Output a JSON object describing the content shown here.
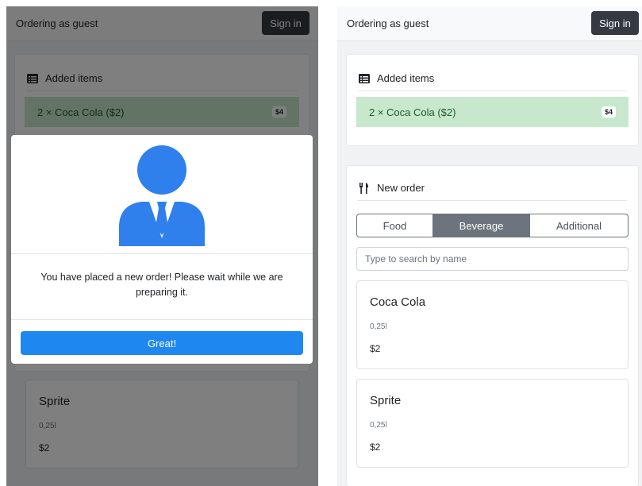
{
  "navbar": {
    "title": "Ordering as guest",
    "signin_label": "Sign in"
  },
  "added_items": {
    "title": "Added items",
    "rows": [
      {
        "text": "2 × Coca Cola ($2)",
        "total": "$4"
      }
    ]
  },
  "new_order": {
    "title": "New order",
    "tabs": [
      {
        "label": "Food"
      },
      {
        "label": "Beverage"
      },
      {
        "label": "Additional"
      }
    ],
    "active_tab": "Beverage",
    "search_placeholder": "Type to search by name"
  },
  "products": [
    {
      "name": "Coca Cola",
      "volume": "0,25l",
      "price": "$2"
    },
    {
      "name": "Sprite",
      "volume": "0,25l",
      "price": "$2"
    }
  ],
  "modal": {
    "message": "You have placed a new order! Please wait while we are preparing it.",
    "button_label": "Great!"
  },
  "colors": {
    "accent": "#1e87f0",
    "icon_blue": "#2f80ed",
    "added_bg": "#c7e8cc",
    "dark_button": "#343a40",
    "active_tab": "#6c757d"
  },
  "icons": {
    "list": "list-icon",
    "utensils": "utensils-icon",
    "user": "user-icon"
  }
}
